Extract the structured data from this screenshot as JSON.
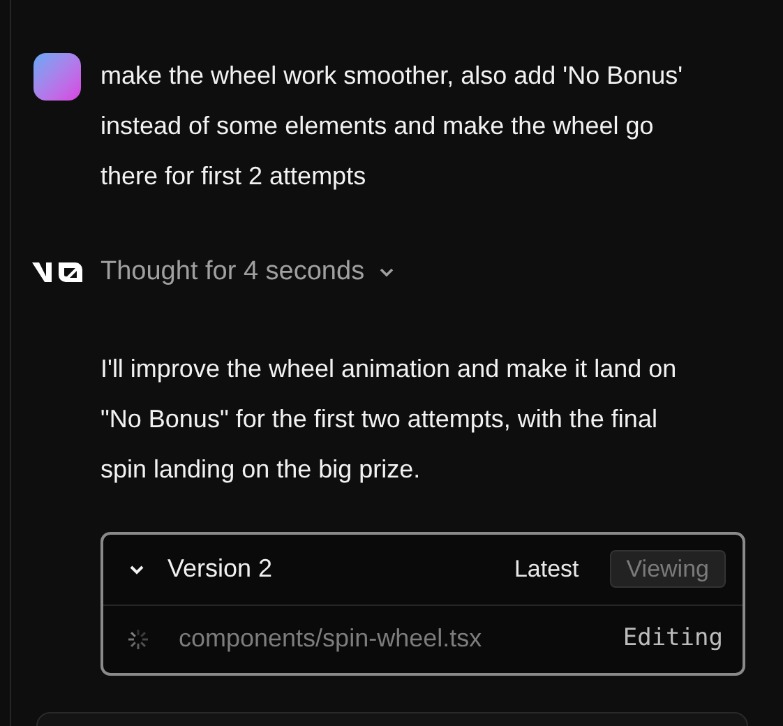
{
  "user_message": {
    "text": "make the wheel work smoother, also add 'No Bonus' instead of some elements and make the wheel go there for first 2 attempts"
  },
  "thought": {
    "label": "Thought for 4 seconds",
    "expanded": false
  },
  "response": {
    "text": "I'll improve the wheel animation and make it land on \"No Bonus\" for the first two attempts, with the final spin landing on the big prize."
  },
  "version_card": {
    "title": "Version 2",
    "expanded": true,
    "tag": "Latest",
    "action": "Viewing",
    "files": [
      {
        "path": "components/spin-wheel.tsx",
        "status": "Editing",
        "loading": true
      }
    ]
  }
}
